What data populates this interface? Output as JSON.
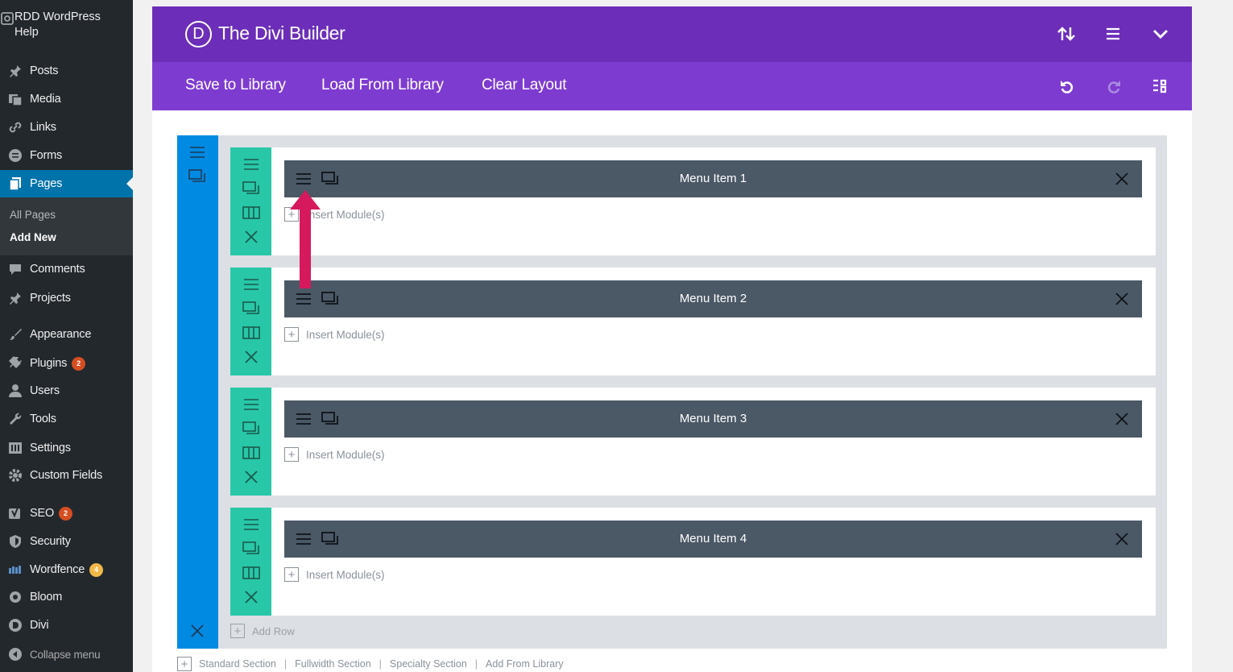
{
  "wp_menu": {
    "site_name_line1": "RDD WordPress",
    "site_name_line2": "Help",
    "items": [
      {
        "label": "Posts",
        "icon": "pin-icon"
      },
      {
        "label": "Media",
        "icon": "media-icon"
      },
      {
        "label": "Links",
        "icon": "link-icon"
      },
      {
        "label": "Forms",
        "icon": "forms-icon"
      },
      {
        "label": "Pages",
        "icon": "pages-icon"
      },
      {
        "label": "Comments",
        "icon": "comment-icon"
      },
      {
        "label": "Projects",
        "icon": "pin-icon"
      },
      {
        "label": "Appearance",
        "icon": "brush-icon"
      },
      {
        "label": "Plugins",
        "icon": "plugin-icon",
        "badge": "2"
      },
      {
        "label": "Users",
        "icon": "user-icon"
      },
      {
        "label": "Tools",
        "icon": "wrench-icon"
      },
      {
        "label": "Settings",
        "icon": "settings-icon"
      },
      {
        "label": "Custom Fields",
        "icon": "gear-icon"
      },
      {
        "label": "SEO",
        "icon": "yoast-icon",
        "badge": "2"
      },
      {
        "label": "Security",
        "icon": "shield-icon"
      },
      {
        "label": "Wordfence",
        "icon": "wordfence-icon",
        "badge": "4"
      },
      {
        "label": "Bloom",
        "icon": "bloom-icon"
      },
      {
        "label": "Divi",
        "icon": "divi-icon"
      },
      {
        "label": "Collapse menu",
        "icon": "collapse-icon"
      }
    ],
    "submenu": {
      "all_pages": "All Pages",
      "add_new": "Add New"
    }
  },
  "builder": {
    "logo": "D",
    "title": "The Divi Builder",
    "toolbar": {
      "save": "Save to Library",
      "load": "Load From Library",
      "clear": "Clear Layout"
    },
    "rows": [
      {
        "module_label": "Menu Item 1",
        "insert_label": "Insert Module(s)"
      },
      {
        "module_label": "Menu Item 2",
        "insert_label": "Insert Module(s)"
      },
      {
        "module_label": "Menu Item 3",
        "insert_label": "Insert Module(s)"
      },
      {
        "module_label": "Menu Item 4",
        "insert_label": "Insert Module(s)"
      }
    ],
    "add_row": "Add Row",
    "section_links": [
      "Standard Section",
      "Fullwidth Section",
      "Specialty Section",
      "Add From Library"
    ]
  },
  "colors": {
    "header": "#6c2eb9",
    "toolbar": "#7e3bd0",
    "section": "#008ae1",
    "row": "#28c7a8",
    "module": "#4b5866",
    "arrow": "#d6195c"
  }
}
